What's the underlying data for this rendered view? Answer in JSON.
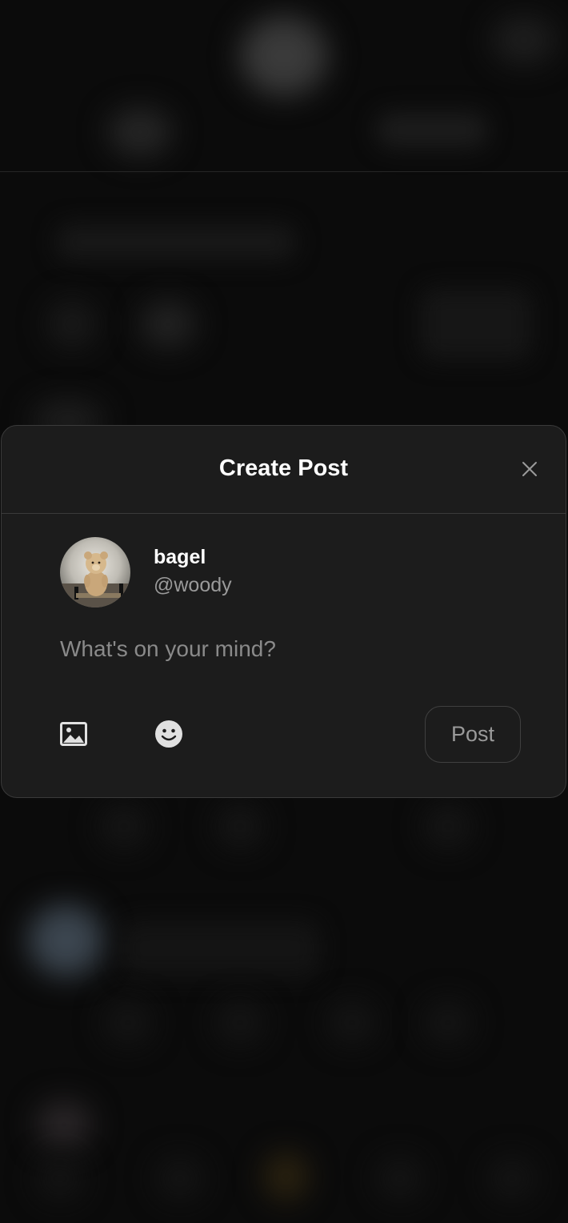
{
  "modal": {
    "title": "Create Post",
    "close_icon": "close-icon"
  },
  "user": {
    "display_name": "bagel",
    "handle": "@woody",
    "avatar": "teddy-bear-avatar"
  },
  "composer": {
    "placeholder": "What's on your mind?",
    "value": ""
  },
  "toolbar": {
    "image_icon": "image-icon",
    "emoji_icon": "emoji-icon",
    "post_label": "Post"
  },
  "colors": {
    "modal_background": "#1c1c1c",
    "backdrop": "#0b0b0b",
    "border": "#3a3a3a",
    "text_primary": "#ffffff",
    "text_secondary": "#9a9a9a",
    "icon": "#e0e0e0"
  }
}
